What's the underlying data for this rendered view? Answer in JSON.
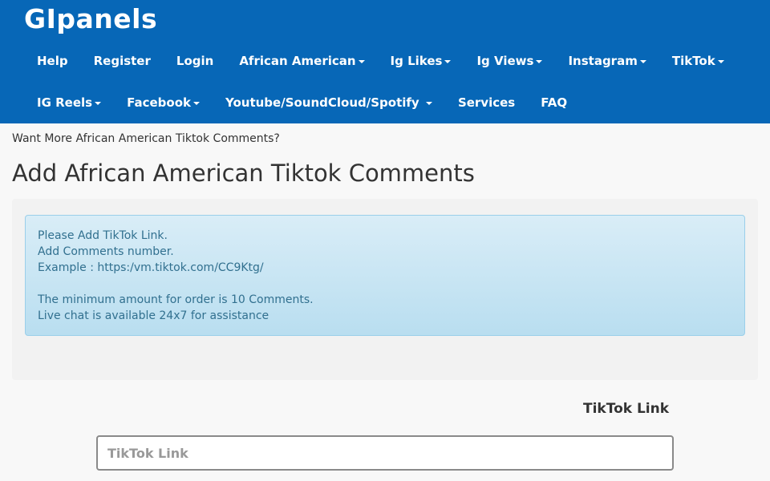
{
  "brand": "GIpanels",
  "nav": {
    "row1": [
      {
        "label": "Help",
        "dropdown": false
      },
      {
        "label": "Register",
        "dropdown": false
      },
      {
        "label": "Login",
        "dropdown": false
      },
      {
        "label": "African American",
        "dropdown": true
      },
      {
        "label": "Ig Likes",
        "dropdown": true
      },
      {
        "label": "Ig Views",
        "dropdown": true
      },
      {
        "label": "Instagram",
        "dropdown": true
      },
      {
        "label": "TikTok",
        "dropdown": true
      }
    ],
    "row2": [
      {
        "label": "IG Reels",
        "dropdown": true
      },
      {
        "label": "Facebook",
        "dropdown": true
      },
      {
        "label": "Youtube/SoundCloud/Spotify ",
        "dropdown": true
      },
      {
        "label": "Services",
        "dropdown": false
      },
      {
        "label": "FAQ",
        "dropdown": false
      }
    ]
  },
  "subheading": "Want More African American Tiktok Comments?",
  "page_title": "Add African American Tiktok Comments",
  "info": {
    "lines": [
      "Please Add TikTok Link.",
      "Add Comments number.",
      "Example : https:/vm.tiktok.com/CC9Ktg/",
      "",
      "The minimum amount for order is 10 Comments.",
      "Live chat is available 24x7 for assistance"
    ]
  },
  "form": {
    "link_label": "TikTok Link",
    "link_placeholder": "TikTok Link"
  },
  "colors": {
    "header_bg": "#0767b7",
    "alert_bg": "#d9edf7",
    "alert_text": "#31708f"
  }
}
